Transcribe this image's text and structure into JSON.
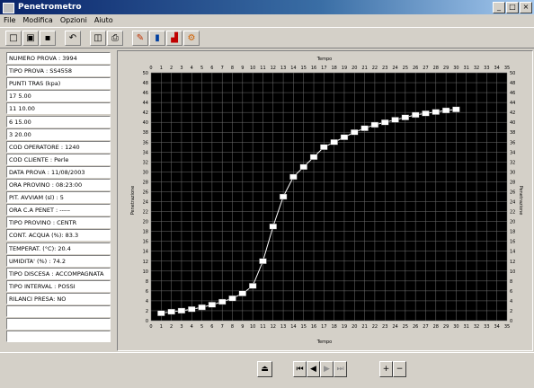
{
  "window": {
    "title": "Penetrometro"
  },
  "menu": [
    "File",
    "Modifica",
    "Opzioni",
    "Aiuto"
  ],
  "toolbar": {
    "buttons": [
      "new-icon",
      "open-icon",
      "save-icon",
      "undo-icon",
      "preview-icon",
      "print-icon",
      "pen-icon",
      "bar-icon",
      "chart-icon",
      "settings-icon"
    ]
  },
  "fields": [
    "NUMERO PROVA : 3994",
    "TIPO PROVA : SS4558",
    "PUNTI TRAS (kpa)",
    "17 5.00",
    "11 10.00",
    "6 15.00",
    "3 20.00",
    "COD OPERATORE : 1240",
    "COD CLIENTE : Perle",
    "DATA PROVA : 11/08/2003",
    "ORA PROVINO : 08:23:00",
    "PIT. AVVIAM (sl) : 5",
    "ORA C.A PENET : -----",
    "TIPO PROVINO : CENTR",
    "CONT. ACQUA (%): 83.3",
    "TEMPERAT. (°C): 20.4",
    "UMIDITA' (%) : 74.2",
    "TIPO DISCESA : ACCOMPAGNATA",
    "TIPO INTERVAL : POSSI",
    "RILANCI PRESA: NO",
    "",
    "",
    ""
  ],
  "chart_data": {
    "type": "line",
    "title": "",
    "xlabel": "Tempo",
    "ylabel": "Penetrazione",
    "xlim": [
      0,
      35
    ],
    "ylim": [
      0,
      50
    ],
    "xticks": [
      0,
      1,
      2,
      3,
      4,
      5,
      6,
      7,
      8,
      9,
      10,
      11,
      12,
      13,
      14,
      15,
      16,
      17,
      18,
      19,
      20,
      21,
      22,
      23,
      24,
      25,
      26,
      27,
      28,
      29,
      30,
      31,
      32,
      33,
      34,
      35
    ],
    "yticks": [
      0,
      2,
      4,
      6,
      8,
      10,
      12,
      14,
      16,
      18,
      20,
      22,
      24,
      26,
      28,
      30,
      32,
      34,
      36,
      38,
      40,
      42,
      44,
      46,
      48,
      50
    ],
    "grid": true,
    "series": [
      {
        "x": [
          1,
          2,
          3,
          4,
          5,
          6,
          7,
          8,
          9,
          10,
          11,
          12,
          13,
          14,
          15,
          16,
          17,
          18,
          19,
          20,
          21,
          22,
          23,
          24,
          25,
          26,
          27,
          28,
          29,
          30
        ],
        "y": [
          1.5,
          1.8,
          2.0,
          2.3,
          2.7,
          3.2,
          3.8,
          4.5,
          5.5,
          7.0,
          12,
          19,
          25,
          29,
          31,
          33,
          35,
          36,
          37,
          38,
          38.8,
          39.5,
          40,
          40.5,
          41,
          41.5,
          41.8,
          42.1,
          42.4,
          42.6
        ]
      }
    ],
    "colors": {
      "background": "#000000",
      "grid": "#707070",
      "line": "#ffffff",
      "marker": "#ffffff",
      "tick_text": "#000000"
    }
  },
  "navigator": [
    "home-icon",
    "first-icon",
    "prev-icon",
    "next-icon",
    "last-icon",
    "add-icon",
    "remove-icon"
  ]
}
